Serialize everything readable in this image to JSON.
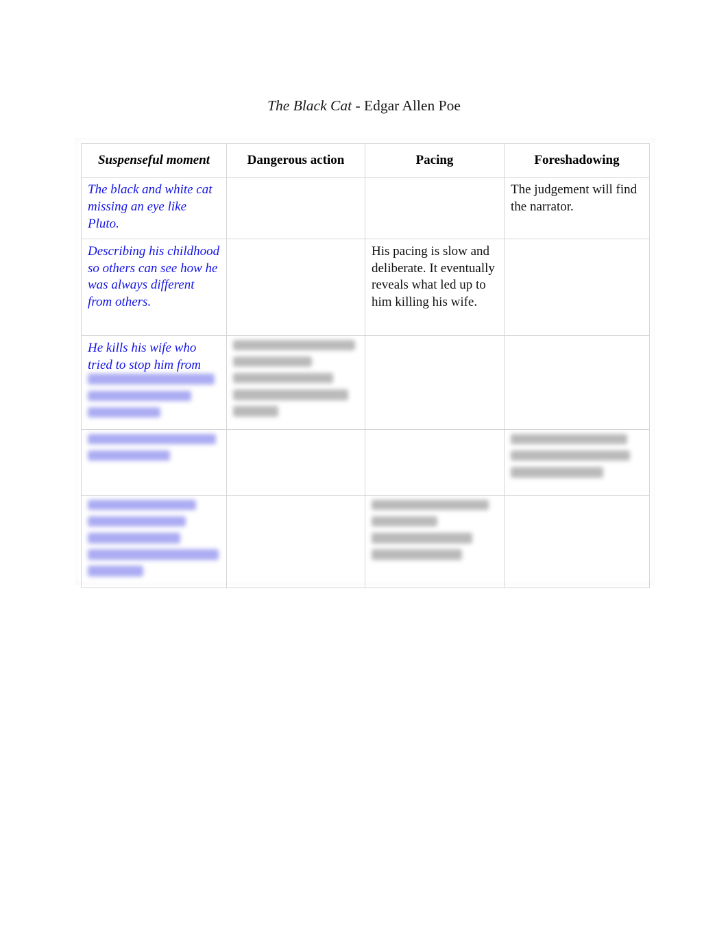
{
  "document": {
    "title_italic": "The Black Cat",
    "title_rest": " - Edgar Allen Poe"
  },
  "table": {
    "headers": [
      {
        "label": "Suspenseful moment",
        "color": "#1414e6",
        "style": "bold-italic"
      },
      {
        "label": "Dangerous action",
        "color": "#000000",
        "style": "bold"
      },
      {
        "label": "Pacing",
        "color": "#000000",
        "style": "bold"
      },
      {
        "label": "Foreshadowing",
        "color": "#000000",
        "style": "bold"
      }
    ],
    "rows": [
      {
        "suspenseful_moment": "The black and white cat missing an eye like Pluto.",
        "dangerous_action": "",
        "pacing": "",
        "foreshadowing": "The judgement will find the narrator."
      },
      {
        "suspenseful_moment": "Describing his childhood so others can see how he was always different from others.",
        "dangerous_action": "",
        "pacing": "His pacing is slow and deliberate. It eventually reveals what led up to him killing his wife.",
        "foreshadowing": ""
      },
      {
        "suspenseful_moment": "He kills his wife who tried to stop him from",
        "suspenseful_moment_redacted_lines": 3,
        "dangerous_action": "",
        "dangerous_action_redacted_lines": 5,
        "pacing": "",
        "foreshadowing": ""
      },
      {
        "suspenseful_moment": "",
        "suspenseful_moment_redacted_lines": 2,
        "dangerous_action": "",
        "pacing": "",
        "foreshadowing": "",
        "foreshadowing_redacted_lines": 3
      },
      {
        "suspenseful_moment": "",
        "suspenseful_moment_redacted_lines": 5,
        "dangerous_action": "",
        "pacing": "",
        "pacing_redacted_lines": 4,
        "foreshadowing": ""
      }
    ]
  },
  "colors": {
    "accent_blue": "#1414e6",
    "text_black": "#111111",
    "border_grey": "#d6d6d6",
    "page_background": "#ffffff"
  }
}
